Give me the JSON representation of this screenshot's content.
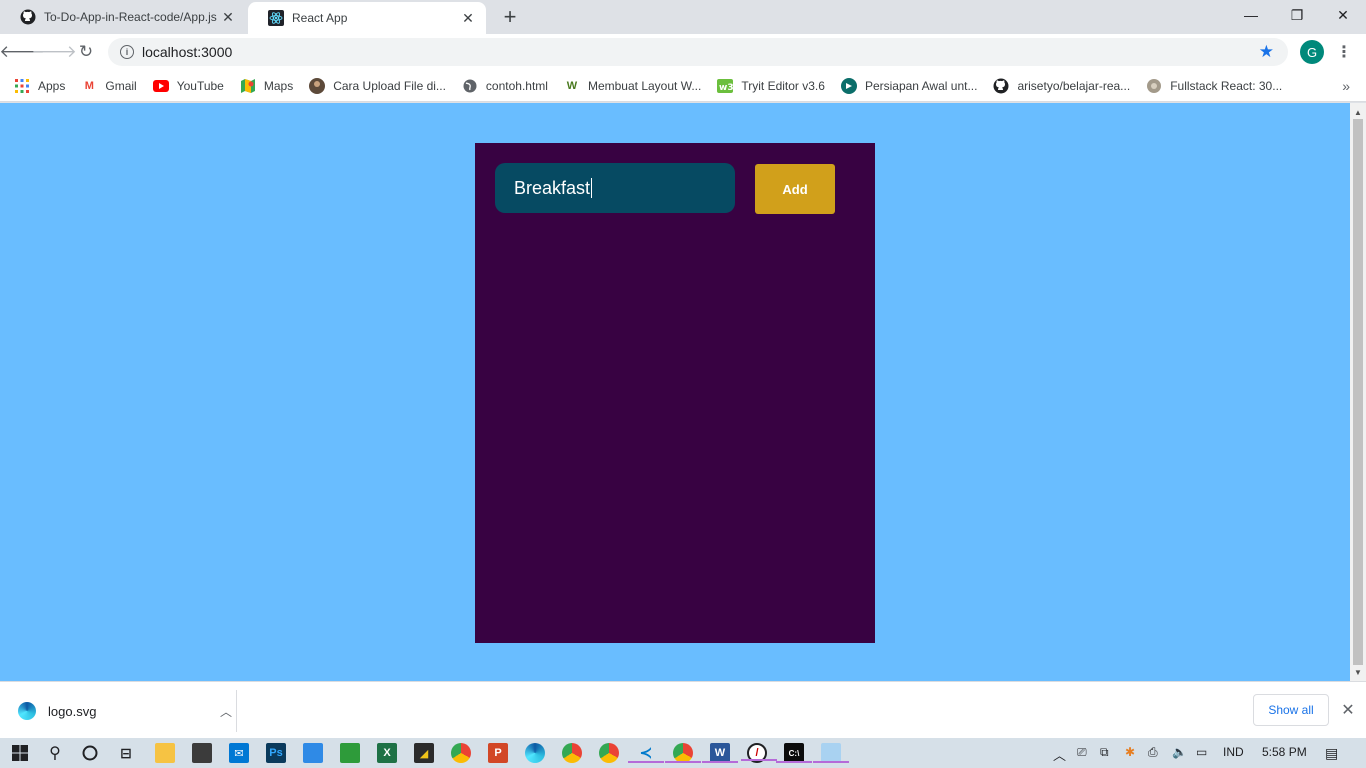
{
  "browser": {
    "tabs": [
      {
        "title": "To-Do-App-in-React-code/App.js",
        "icon": "github-icon",
        "active": false
      },
      {
        "title": "React App",
        "icon": "react-icon",
        "active": true
      }
    ],
    "url": "localhost:3000",
    "avatar_letter": "G",
    "bookmarks": [
      {
        "label": "Apps",
        "icon": "apps-grid-icon"
      },
      {
        "label": "Gmail",
        "icon": "gmail-icon"
      },
      {
        "label": "YouTube",
        "icon": "youtube-icon"
      },
      {
        "label": "Maps",
        "icon": "maps-icon"
      },
      {
        "label": "Cara Upload File di...",
        "icon": "avatar-icon"
      },
      {
        "label": "contoh.html",
        "icon": "globe-icon"
      },
      {
        "label": "Membuat Layout W...",
        "icon": "w-logo-icon"
      },
      {
        "label": "Tryit Editor v3.6",
        "icon": "w3schools-icon"
      },
      {
        "label": "Persiapan Awal unt...",
        "icon": "site-icon"
      },
      {
        "label": "arisetyo/belajar-rea...",
        "icon": "github-icon"
      },
      {
        "label": "Fullstack React: 30...",
        "icon": "fullstack-icon"
      }
    ]
  },
  "app": {
    "input_value": "Breakfast",
    "add_label": "Add",
    "colors": {
      "page_bg": "#69bdff",
      "card_bg": "#380242",
      "input_bg": "#064a62",
      "button_bg": "#d1a01b"
    }
  },
  "downloads": {
    "file_name": "logo.svg",
    "show_all_label": "Show all"
  },
  "taskbar": {
    "language": "IND",
    "time": "5:58 PM"
  }
}
